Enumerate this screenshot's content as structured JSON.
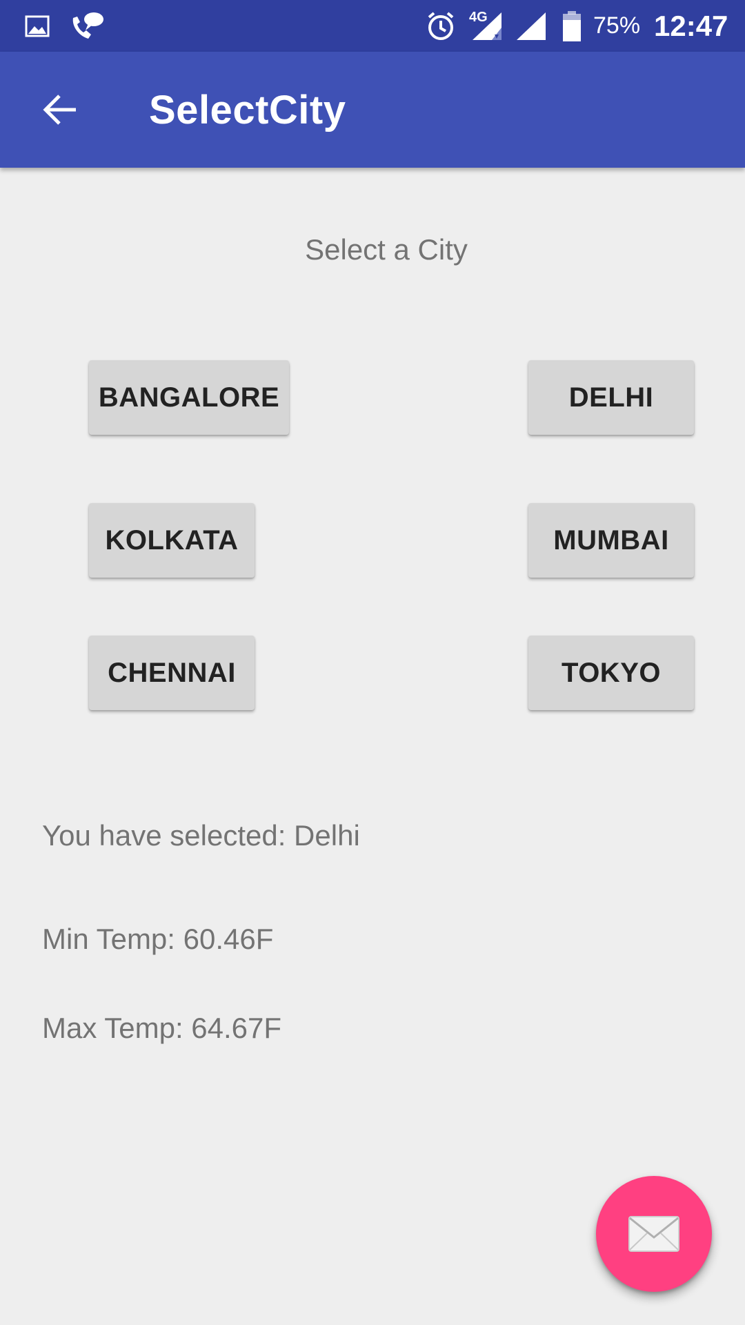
{
  "status_bar": {
    "battery_text": "75%",
    "time": "12:47",
    "network_label": "4G",
    "icons": [
      "image-icon",
      "call-chat-icon",
      "alarm-icon",
      "cell-signal-4g-icon",
      "cell-signal-icon",
      "battery-icon"
    ]
  },
  "app_bar": {
    "title": "SelectCity",
    "back_icon": "arrow-back-icon"
  },
  "main": {
    "prompt": "Select a City",
    "buttons": [
      {
        "label": "BANGALORE"
      },
      {
        "label": "DELHI"
      },
      {
        "label": "KOLKATA"
      },
      {
        "label": "MUMBAI"
      },
      {
        "label": "CHENNAI"
      },
      {
        "label": "TOKYO"
      }
    ],
    "selected_text": "You have selected: Delhi",
    "min_temp": "Min Temp: 60.46F",
    "max_temp": "Max Temp: 64.67F"
  },
  "fab": {
    "icon": "mail-icon"
  },
  "colors": {
    "status_bar": "#303f9f",
    "app_bar": "#3f51b5",
    "background": "#eeeeee",
    "button": "#d6d6d6",
    "fab": "#ff4081"
  }
}
